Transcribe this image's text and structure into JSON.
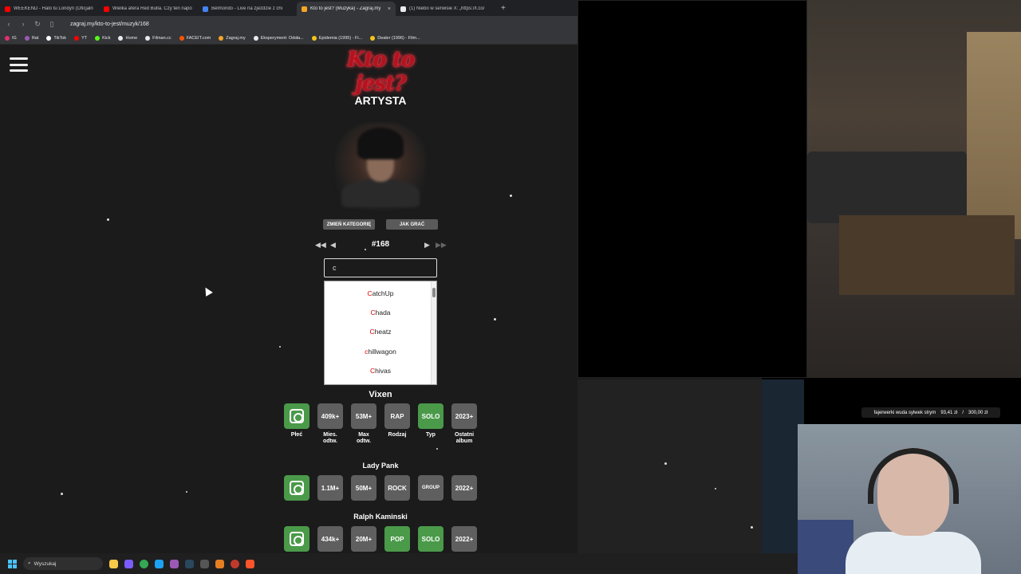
{
  "browser": {
    "tabs": [
      {
        "title": "WEEKEND - Halo tu Londyn (Oficjaln",
        "color": "#ff0000"
      },
      {
        "title": "Wielka afera Red Bulla. Czy ten napó",
        "color": "#ff0000"
      },
      {
        "title": "Belmondo - Live na zjeździe z chi",
        "color": "#4285f4"
      },
      {
        "title": "Kto to jest? (Muzyka) - Zagraj.my",
        "color": "#f5a623"
      },
      {
        "title": "(1) Niebo w serwisie X: „https://t.co/",
        "color": "#e8eaed"
      }
    ],
    "active_tab_close": "×",
    "new_tab": "+",
    "url": "zagraj.my/kto-to-jest/muzyk/168",
    "bookmarks": [
      {
        "label": "IG",
        "color": "#e1306c"
      },
      {
        "label": "Rat",
        "color": "#9b59b6"
      },
      {
        "label": "TikTok",
        "color": "#ffffff"
      },
      {
        "label": "YT",
        "color": "#ff0000"
      },
      {
        "label": "Kick",
        "color": "#53fc18"
      },
      {
        "label": "Home",
        "color": "#e8eaed"
      },
      {
        "label": "Filman.cc",
        "color": "#e8eaed"
      },
      {
        "label": "FACEIT.com",
        "color": "#ff5500"
      },
      {
        "label": "Zagraj.my",
        "color": "#f5a623"
      },
      {
        "label": "Eksperyment: Odsła...",
        "color": "#e8eaed"
      },
      {
        "label": "Epidemia (1995) - Fi...",
        "color": "#f5c518"
      },
      {
        "label": "Dealer (1996) - Film...",
        "color": "#f5c518"
      }
    ]
  },
  "page": {
    "logo": "Kto to jest?",
    "category": "ARTYSTA",
    "buttons": {
      "change_category": "ZMIEŃ KATEGORIĘ",
      "how_to_play": "JAK GRAĆ"
    },
    "puzzle_number": "#168",
    "search_value": "c",
    "dropdown": [
      {
        "hl": "C",
        "rest": "atchUp"
      },
      {
        "hl": "C",
        "rest": "hada"
      },
      {
        "hl": "C",
        "rest": "heatz"
      },
      {
        "hl": "c",
        "rest": "hillwagon"
      },
      {
        "hl": "C",
        "rest": "hivas"
      }
    ],
    "labels": [
      "Płeć",
      "Mies.\nodtw.",
      "Max\nodtw.",
      "Rodzaj",
      "Typ",
      "Ostatni\nalbum"
    ],
    "guesses": [
      {
        "name": "Vixen",
        "tiles": [
          "",
          "409k+",
          "53M+",
          "RAP",
          "SOLO",
          "2023+"
        ],
        "green": [
          true,
          false,
          false,
          false,
          true,
          false
        ]
      },
      {
        "name": "Lady Pank",
        "tiles": [
          "",
          "1.1M+",
          "50M+",
          "ROCK",
          "GROUP",
          "2022+"
        ],
        "green": [
          true,
          false,
          false,
          false,
          false,
          false
        ]
      },
      {
        "name": "Ralph Kaminski",
        "tiles": [
          "",
          "434k+",
          "20M+",
          "POP",
          "SOLO",
          "2022+"
        ],
        "green": [
          true,
          false,
          false,
          true,
          true,
          false
        ]
      }
    ]
  },
  "stream": {
    "donation": "fajerwerki wuda sylwek strym",
    "donation_current": "93,41 zł",
    "donation_sep": "/",
    "donation_goal": "300,00 zł"
  },
  "taskbar": {
    "search": "Wyszukaj"
  }
}
